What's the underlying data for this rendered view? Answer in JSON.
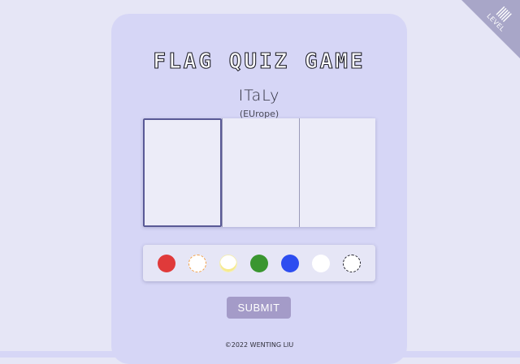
{
  "game": {
    "title": "FLAG QUIZ GAME",
    "country": "ITaLy",
    "continent": "(EUrope)"
  },
  "flag": {
    "stripes": [
      {
        "name": "stripe-left",
        "selected": true
      },
      {
        "name": "stripe-middle",
        "selected": false
      },
      {
        "name": "stripe-right",
        "selected": false
      }
    ]
  },
  "palette": {
    "colors": [
      {
        "name": "red",
        "hex": "#e03a3a"
      },
      {
        "name": "orange",
        "hex": "#f3a046"
      },
      {
        "name": "yellow",
        "hex": "#f6ea8c"
      },
      {
        "name": "green",
        "hex": "#3a9630"
      },
      {
        "name": "blue",
        "hex": "#2d4df0"
      },
      {
        "name": "white",
        "hex": "#ffffff"
      },
      {
        "name": "black-outline-white",
        "hex": "#ffffff"
      }
    ]
  },
  "actions": {
    "submit_label": "SUBMIT"
  },
  "footer": {
    "copyright": "©2022 WENTING LIU"
  },
  "corner": {
    "label": "LEVEL",
    "icon": "barcode-icon"
  },
  "colors": {
    "background": "#e6e6f6",
    "card": "#d6d6f6",
    "button": "#a49bc8",
    "selected_border": "#5a5a96"
  }
}
